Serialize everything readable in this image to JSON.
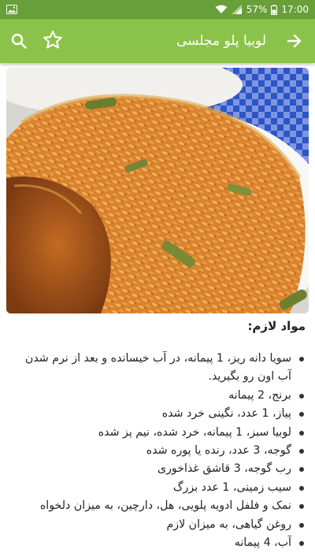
{
  "status_bar": {
    "battery": "57%",
    "time": "17:00",
    "icons": [
      "image-icon",
      "wifi-icon",
      "signal-icon",
      "battery-icon"
    ]
  },
  "app_bar": {
    "title": "لوبیا پلو مجلسی",
    "icons": [
      "search-icon",
      "star-outline-icon",
      "arrow-forward-icon"
    ],
    "color": "#8bc34a",
    "status_color": "#689f38"
  },
  "content": {
    "section_title": "مواد لازم:",
    "ingredients": [
      "سویا دانه ریز، 1 پیمانه، در آب خیسانده و بعد از نرم شدن آب اون رو بگیرید.",
      "برنج، 2 پیمانه",
      "پیاز، 1 عدد، نگینی خرد شده",
      "لوبیا سبز، 1 پیمانه، خرد شده، نیم پز شده",
      "گوجه، 3 عدد، رنده یا پوره شده",
      "رب گوجه، 3 قاشق غذاخوری",
      "سیب زمینی، 1 عدد بزرگ",
      "نمک و فلفل ادویه پلویی، هل، دارچین، به میزان دلخواه",
      "روغن گیاهی، به میزان لازم",
      "آب، 4 پیمانه"
    ]
  }
}
